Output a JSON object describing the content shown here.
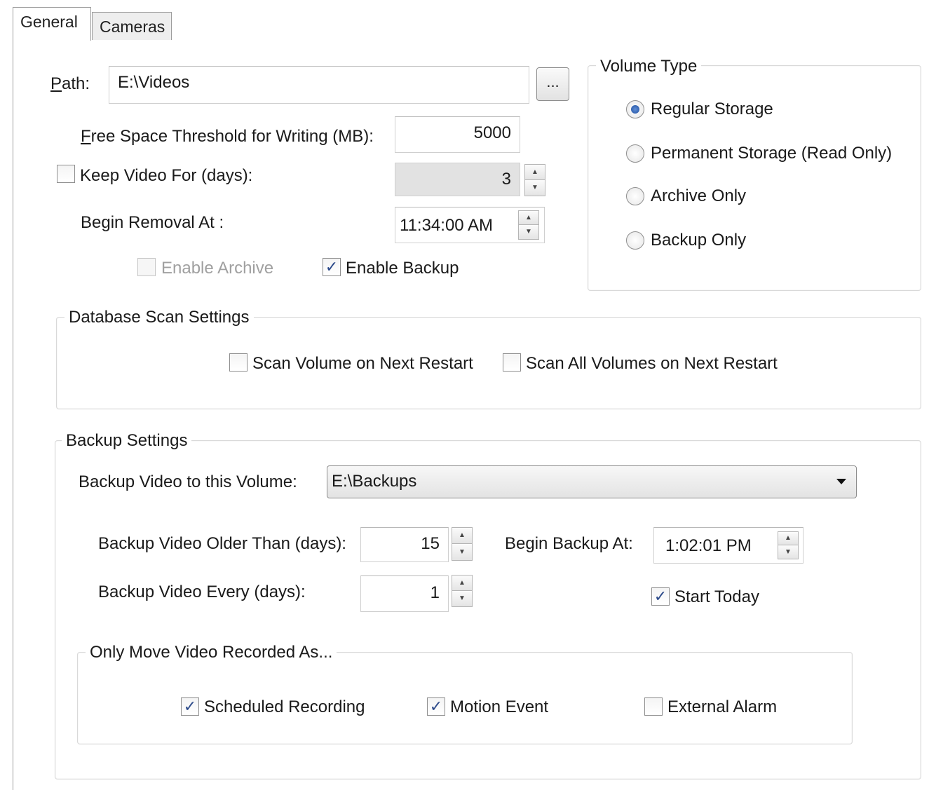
{
  "tabs": {
    "general": "General",
    "cameras": "Cameras"
  },
  "path": {
    "label": "Path:",
    "value": "E:\\Videos",
    "browse_label": "..."
  },
  "free_space": {
    "label": "Free Space Threshold for Writing (MB):",
    "value": "5000"
  },
  "keep_video": {
    "label": "Keep Video For (days):",
    "value": "3",
    "checked": false
  },
  "begin_removal": {
    "label": "Begin Removal At :",
    "value": "11:34:00 AM"
  },
  "enable_archive": {
    "label": "Enable Archive",
    "checked": false,
    "disabled": true
  },
  "enable_backup": {
    "label": "Enable Backup",
    "checked": true
  },
  "volume_type": {
    "title": "Volume Type",
    "options": [
      {
        "label": "Regular Storage",
        "selected": true
      },
      {
        "label": "Permanent Storage (Read Only)",
        "selected": false
      },
      {
        "label": "Archive Only",
        "selected": false
      },
      {
        "label": "Backup Only",
        "selected": false
      }
    ]
  },
  "database_scan": {
    "title": "Database Scan Settings",
    "scan_volume_label": "Scan Volume on Next Restart",
    "scan_all_label": "Scan All Volumes on Next Restart"
  },
  "backup_settings": {
    "title": "Backup Settings",
    "volume_label": "Backup Video to this Volume:",
    "volume_value": "E:\\Backups",
    "older_than_label": "Backup Video Older Than (days):",
    "older_than_value": "15",
    "every_label": "Backup Video Every (days):",
    "every_value": "1",
    "begin_label": "Begin Backup At:",
    "begin_value": "1:02:01 PM",
    "start_today_label": "Start Today",
    "start_today_checked": true
  },
  "only_move": {
    "title": "Only Move Video Recorded As...",
    "scheduled_label": "Scheduled Recording",
    "scheduled_checked": true,
    "motion_label": "Motion Event",
    "motion_checked": true,
    "external_label": "External Alarm",
    "external_checked": false
  },
  "icons": {
    "check": "checkmark-icon",
    "spin_up": "spin-up-icon",
    "spin_down": "spin-down-icon",
    "dropdown": "dropdown-arrow-icon"
  }
}
